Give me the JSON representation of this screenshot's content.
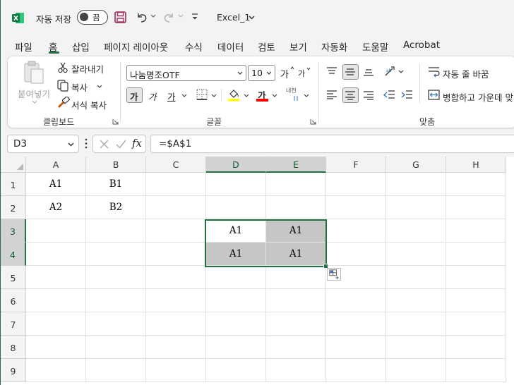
{
  "titlebar": {
    "autosave_label": "자동 저장",
    "autosave_toggle": "끔",
    "filename": "Excel_1"
  },
  "tabs": [
    {
      "label": "파일"
    },
    {
      "label": "홈"
    },
    {
      "label": "삽입"
    },
    {
      "label": "페이지 레이아웃"
    },
    {
      "label": "수식"
    },
    {
      "label": "데이터"
    },
    {
      "label": "검토"
    },
    {
      "label": "보기"
    },
    {
      "label": "자동화"
    },
    {
      "label": "도움말"
    },
    {
      "label": "Acrobat"
    }
  ],
  "ribbon": {
    "clipboard": {
      "paste": "붙여넣기",
      "cut": "잘라내기",
      "copy": "복사",
      "format_painter": "서식 복사",
      "group": "클립보드"
    },
    "font": {
      "font_name": "나눔명조OTF",
      "font_size": "10",
      "bold": "가",
      "italic": "가",
      "underline": "가",
      "font_color_glyph": "가",
      "phonetic": "내천",
      "grow_glyph": "가",
      "shrink_glyph": "가",
      "group": "글꼴"
    },
    "alignment": {
      "wrap_text": "자동 줄 바꿈",
      "merge_center": "병합하고 가운데 맞",
      "group": "맞춤"
    },
    "accent": "#1f7244"
  },
  "formula_bar": {
    "name_box": "D3",
    "fx": "fx",
    "formula": "=$A$1"
  },
  "grid": {
    "columns": [
      "A",
      "B",
      "C",
      "D",
      "E",
      "F",
      "G",
      "H"
    ],
    "rows": [
      "1",
      "2",
      "3",
      "4",
      "5",
      "6",
      "7",
      "8",
      "9"
    ],
    "cells": {
      "A1": "A1",
      "B1": "B1",
      "A2": "A2",
      "B2": "B2",
      "D3": "A1",
      "E3": "A1",
      "D4": "A1",
      "E4": "A1"
    },
    "selection": "D3:E4"
  }
}
